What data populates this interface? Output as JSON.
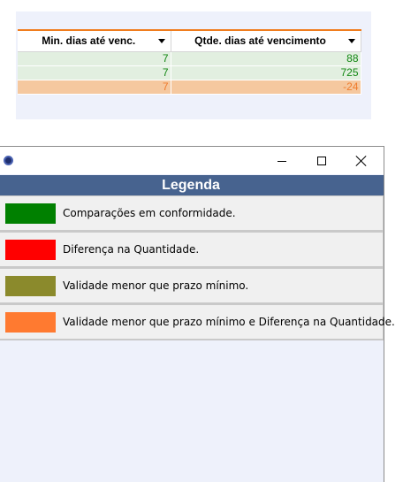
{
  "grid": {
    "columns": [
      {
        "label": "Min. dias até venc."
      },
      {
        "label": "Qtde. dias até vencimento"
      }
    ],
    "rows": [
      {
        "min_dias": "7",
        "qtde_dias": "88",
        "status": "ok"
      },
      {
        "min_dias": "7",
        "qtde_dias": "725",
        "status": "ok"
      },
      {
        "min_dias": "7",
        "qtde_dias": "-24",
        "status": "warn"
      }
    ]
  },
  "legend_window": {
    "title_icon": "app-icon",
    "controls": {
      "minimize": "minimize-icon",
      "maximize": "maximize-icon",
      "close": "close-icon"
    },
    "header": "Legenda",
    "items": [
      {
        "color": "#008000",
        "text": "Comparações em conformidade."
      },
      {
        "color": "#ff0000",
        "text": "Diferença na Quantidade."
      },
      {
        "color": "#8b8a2c",
        "text": "Validade menor que prazo mínimo."
      },
      {
        "color": "#ff7a30",
        "text": "Validade menor que prazo mínimo e Diferença na Quantidade."
      }
    ]
  },
  "colors": {
    "header_accent": "#f07d1e",
    "row_ok_bg": "#e2efe0",
    "row_ok_text": "#128712",
    "row_warn_bg": "#f5c89f",
    "row_warn_text": "#ef7b2c",
    "legend_header_bg": "#47638f"
  }
}
